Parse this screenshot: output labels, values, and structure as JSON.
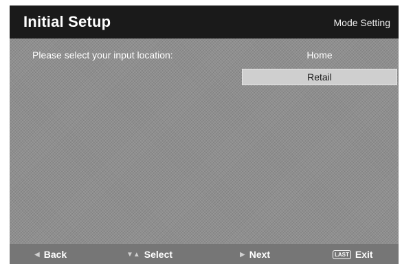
{
  "header": {
    "title": "Initial Setup",
    "mode": "Mode Setting"
  },
  "main": {
    "prompt": "Please select your input location:",
    "options": [
      {
        "label": "Home",
        "selected": false
      },
      {
        "label": "Retail",
        "selected": true
      }
    ]
  },
  "footer": {
    "back": {
      "icon": "left-triangle-icon",
      "label": "Back"
    },
    "select": {
      "icon": "up-down-triangle-icon",
      "label": "Select"
    },
    "next": {
      "icon": "right-triangle-icon",
      "label": "Next"
    },
    "exit": {
      "icon": "last-key-icon",
      "icon_text": "LAST",
      "label": "Exit"
    }
  }
}
